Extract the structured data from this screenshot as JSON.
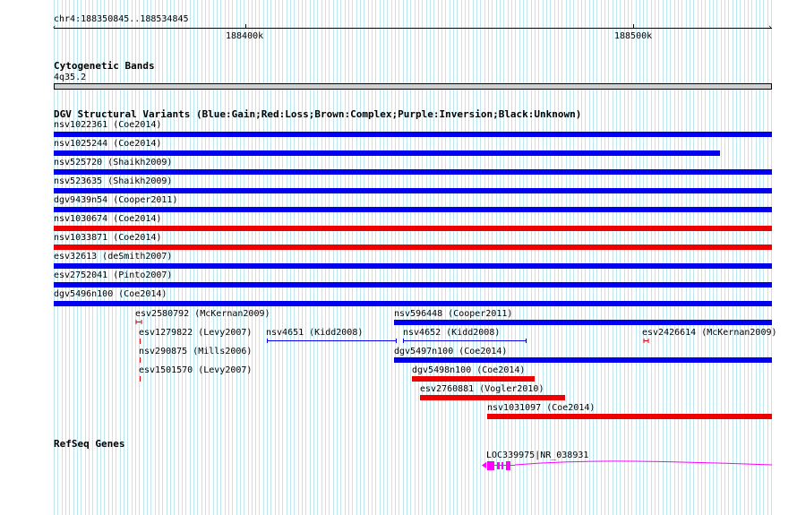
{
  "ruler": {
    "position_label": "chr4:188350845..188534845",
    "tick_labels": [
      "188400k",
      "188500k"
    ]
  },
  "cytoband": {
    "title": "Cytogenetic Bands",
    "band_label": "4q35.2"
  },
  "dgv": {
    "title": "DGV Structural Variants (Blue:Gain;Red:Loss;Brown:Complex;Purple:Inversion;Black:Unknown)",
    "colors": {
      "gain": "#0000ee",
      "loss": "#ee0000"
    },
    "full_rows": [
      {
        "label": "nsv1022361 (Coe2014)",
        "type": "gain"
      },
      {
        "label": "nsv1025244 (Coe2014)",
        "type": "gain"
      },
      {
        "label": "nsv525720 (Shaikh2009)",
        "type": "gain"
      },
      {
        "label": "nsv523635 (Shaikh2009)",
        "type": "gain"
      },
      {
        "label": "dgv9439n54 (Cooper2011)",
        "type": "gain"
      },
      {
        "label": "nsv1030674 (Coe2014)",
        "type": "loss"
      },
      {
        "label": "nsv1033871 (Coe2014)",
        "type": "loss"
      },
      {
        "label": "esv32613 (deSmith2007)",
        "type": "gain"
      },
      {
        "label": "esv2752041 (Pinto2007)",
        "type": "gain"
      },
      {
        "label": "dgv5496n100 (Coe2014)",
        "type": "gain"
      }
    ],
    "small_features": [
      {
        "label": "esv2580792 (McKernan2009)",
        "type": "loss"
      },
      {
        "label": "esv1279822 (Levy2007)",
        "type": "loss"
      },
      {
        "label": "nsv290875 (Mills2006)",
        "type": "loss"
      },
      {
        "label": "esv1501570 (Levy2007)",
        "type": "loss"
      },
      {
        "label": "nsv4651 (Kidd2008)",
        "type": "unknown"
      },
      {
        "label": "nsv596448 (Cooper2011)",
        "type": "gain"
      },
      {
        "label": "nsv4652 (Kidd2008)",
        "type": "gain"
      },
      {
        "label": "dgv5497n100 (Coe2014)",
        "type": "gain"
      },
      {
        "label": "dgv5498n100 (Coe2014)",
        "type": "loss"
      },
      {
        "label": "esv2760881 (Vogler2010)",
        "type": "loss"
      },
      {
        "label": "nsv1031097 (Coe2014)",
        "type": "loss"
      },
      {
        "label": "esv2426614 (McKernan2009)",
        "type": "loss"
      }
    ]
  },
  "refseq": {
    "title": "RefSeq Genes",
    "gene_label": "LOC339975|NR_038931",
    "gene_color": "#ff00ff"
  }
}
